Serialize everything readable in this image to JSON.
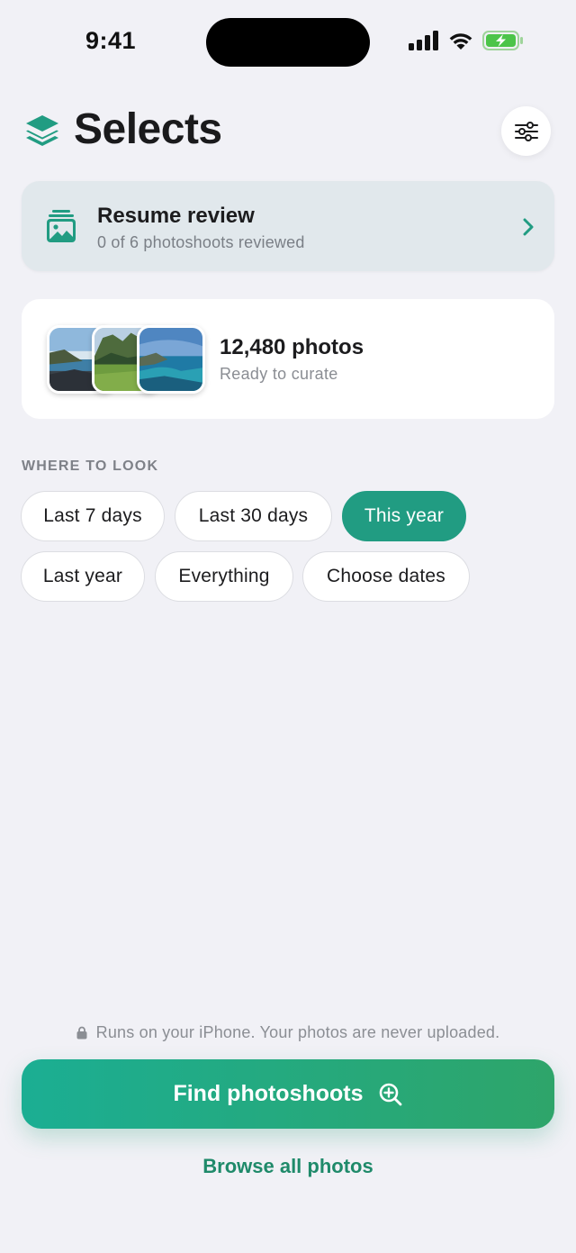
{
  "status_bar": {
    "time": "9:41"
  },
  "header": {
    "title": "Selects",
    "logo_icon": "layers-icon",
    "settings_icon": "sliders-icon"
  },
  "resume": {
    "title": "Resume review",
    "subtitle": "0 of 6 photoshoots reviewed",
    "icon": "photo-stack-icon"
  },
  "library": {
    "count_label": "12,480 photos",
    "subtitle": "Ready to curate"
  },
  "where_to_look": {
    "label": "WHERE TO LOOK",
    "options": [
      {
        "label": "Last 7 days",
        "selected": false
      },
      {
        "label": "Last 30 days",
        "selected": false
      },
      {
        "label": "This year",
        "selected": true
      },
      {
        "label": "Last year",
        "selected": false
      },
      {
        "label": "Everything",
        "selected": false
      },
      {
        "label": "Choose dates",
        "selected": false
      }
    ]
  },
  "footer": {
    "privacy_note": "Runs on your iPhone. Your photos are never uploaded.",
    "find_button": "Find photoshoots",
    "browse_link": "Browse all photos"
  },
  "colors": {
    "accent": "#219c82",
    "background": "#f1f1f6",
    "resume_card": "#e1e8ec"
  }
}
